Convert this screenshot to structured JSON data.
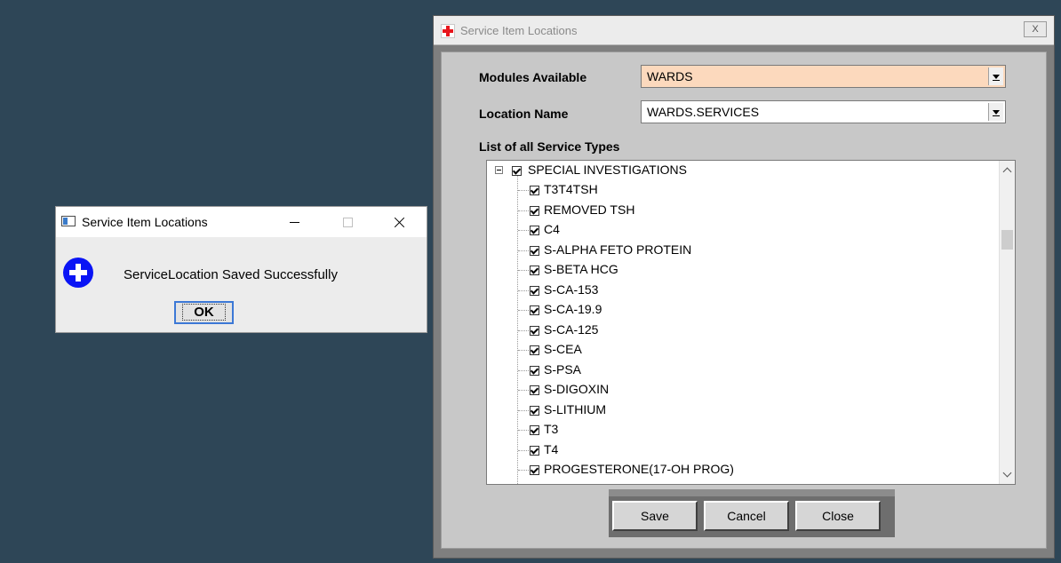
{
  "main_window": {
    "title": "Service Item Locations",
    "close_glyph": "X",
    "modules_label": "Modules Available",
    "modules_value": "WARDS",
    "location_label": "Location Name",
    "location_value": "WARDS.SERVICES",
    "list_label": "List of all Service Types",
    "tree": {
      "root": "SPECIAL INVESTIGATIONS",
      "items": [
        "T3T4TSH",
        "REMOVED TSH",
        "C4",
        "S-ALPHA FETO PROTEIN",
        "S-BETA HCG",
        "S-CA-153",
        "S-CA-19.9",
        "S-CA-125",
        "S-CEA",
        "S-PSA",
        "S-DIGOXIN",
        "S-LITHIUM",
        "T3",
        "T4",
        "PROGESTERONE(17-OH PROG)"
      ]
    },
    "buttons": {
      "save": "Save",
      "cancel": "Cancel",
      "close": "Close"
    },
    "colors": {
      "modules_bg": "#fcd9bd",
      "client_bg": "#c8c8c8"
    }
  },
  "message_box": {
    "title": "Service Item Locations",
    "text": "ServiceLocation Saved Successfully",
    "ok": "OK",
    "icon": "info-plus-icon"
  }
}
